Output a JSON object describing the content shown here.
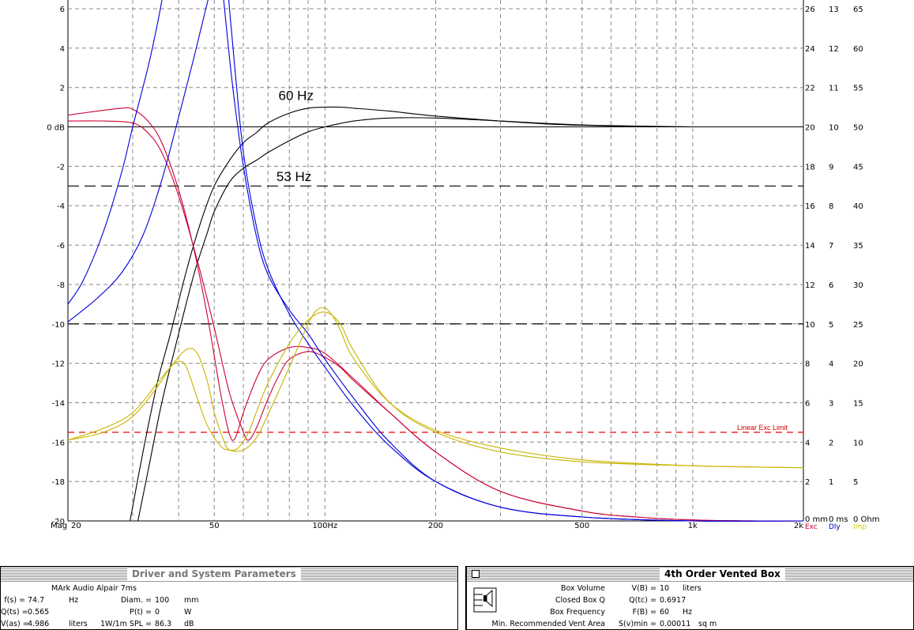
{
  "chart_data": {
    "type": "line",
    "xscale": "log",
    "xlim": [
      20,
      2000
    ],
    "ylim": [
      -20,
      6
    ],
    "x_ticks": [
      "20",
      "50",
      "100Hz",
      "200",
      "500",
      "1k",
      "2k"
    ],
    "x_axis_prefix": "Mag",
    "y_ticks": [
      "6",
      "4",
      "2",
      "0 dB",
      "-2",
      "-4",
      "-6",
      "-8",
      "-10",
      "-12",
      "-14",
      "-16",
      "-18",
      "-20"
    ],
    "right_axes": [
      {
        "values": [
          "26",
          "24",
          "22",
          "20",
          "18",
          "16",
          "14",
          "12",
          "10",
          "8",
          "6",
          "4",
          "2",
          "0 mm"
        ],
        "label": "Exc",
        "color": "#cc0033"
      },
      {
        "values": [
          "13",
          "12",
          "11",
          "10",
          "9",
          "8",
          "7",
          "6",
          "5",
          "4",
          "3",
          "2",
          "1",
          "0 ms"
        ],
        "label": "Dly",
        "color": "#0000cc"
      },
      {
        "values": [
          "65",
          "60",
          "55",
          "50",
          "45",
          "40",
          "35",
          "30",
          "25",
          "20",
          "15",
          "10",
          "5",
          "0 Ohm"
        ],
        "label": "Imp",
        "color": "#d8d000"
      }
    ],
    "reference_lines": [
      {
        "y": -3,
        "style": "long-dash",
        "color": "#000000"
      },
      {
        "y": -10,
        "style": "long-dash",
        "color": "#000000"
      },
      {
        "y": -15.5,
        "style": "dash",
        "color": "#ee0000",
        "label": "Linear Exc Limit"
      }
    ],
    "annotations": [
      {
        "text": "60 Hz",
        "x": 77,
        "y": 1.6
      },
      {
        "text": "53 Hz",
        "x": 76,
        "y": -2.5
      }
    ],
    "series": [
      {
        "color": "#000000",
        "x": [
          29.5,
          32,
          35,
          38,
          42,
          46,
          50,
          55,
          60,
          65,
          70,
          80,
          90,
          100,
          110,
          120,
          150,
          200,
          300,
          400,
          500,
          700,
          1000
        ],
        "y": [
          -20,
          -16.5,
          -13,
          -10.5,
          -7.3,
          -4.8,
          -3.0,
          -1.7,
          -0.8,
          -0.3,
          0.2,
          0.7,
          0.95,
          1.0,
          1.0,
          0.95,
          0.8,
          0.55,
          0.3,
          0.15,
          0.08,
          0.03,
          0.0
        ]
      },
      {
        "color": "#000000",
        "x": [
          31,
          33,
          36,
          40,
          44,
          48,
          50,
          55,
          60,
          65,
          70,
          80,
          90,
          100,
          120,
          150,
          200,
          300,
          500,
          1000
        ],
        "y": [
          -20,
          -17.5,
          -14,
          -10.5,
          -7.5,
          -5.3,
          -4.3,
          -2.8,
          -2.1,
          -1.7,
          -1.3,
          -0.7,
          -0.25,
          0.0,
          0.3,
          0.45,
          0.45,
          0.3,
          0.1,
          0.0
        ]
      },
      {
        "color": "#cc0033",
        "x": [
          20,
          24,
          28,
          30,
          33,
          36,
          40,
          44,
          48,
          52,
          55,
          57,
          60,
          65,
          70,
          80,
          90,
          100,
          120,
          150,
          200,
          300,
          500,
          700,
          1000,
          1500,
          2000
        ],
        "y": [
          0.6,
          0.8,
          0.95,
          0.9,
          0.3,
          -0.8,
          -3.2,
          -6.2,
          -9.7,
          -13.5,
          -15.6,
          -15.8,
          -14.5,
          -12.8,
          -11.8,
          -11.2,
          -11.2,
          -11.5,
          -12.8,
          -14.5,
          -16.5,
          -18.5,
          -19.5,
          -19.8,
          -19.95,
          -20,
          -20
        ]
      },
      {
        "color": "#cc0033",
        "x": [
          20,
          25,
          30,
          33,
          36,
          40,
          45,
          50,
          55,
          60,
          62,
          65,
          70,
          75,
          80,
          90,
          100,
          110,
          120,
          150,
          200,
          300,
          500,
          700,
          1000,
          1500,
          2000
        ],
        "y": [
          0.3,
          0.3,
          0.2,
          -0.3,
          -1.3,
          -3.5,
          -6.8,
          -10.2,
          -13.5,
          -15.5,
          -15.9,
          -15.3,
          -13.8,
          -12.6,
          -11.8,
          -11.4,
          -11.7,
          -12.2,
          -12.9,
          -14.5,
          -16.5,
          -18.5,
          -19.5,
          -19.8,
          -19.95,
          -20,
          -20
        ]
      },
      {
        "color": "#0000dd",
        "x": [
          20,
          22,
          25,
          28,
          30,
          33,
          35,
          37,
          40,
          42
        ],
        "y": [
          -9.0,
          -7.8,
          -5.3,
          -2.3,
          0.0,
          3.0,
          5.2,
          7.5,
          10.0,
          12.0
        ]
      },
      {
        "color": "#0000dd",
        "x": [
          20,
          24,
          28,
          32,
          36,
          40,
          44,
          47,
          49,
          50
        ],
        "y": [
          -9.9,
          -8.7,
          -7.4,
          -5.5,
          -2.7,
          0.5,
          3.5,
          5.7,
          7.1,
          8.0
        ]
      },
      {
        "color": "#0000dd",
        "x": [
          52,
          53,
          55,
          57,
          60,
          65,
          70,
          80,
          90,
          100,
          120,
          150,
          200,
          300,
          500,
          1000,
          2000
        ],
        "y": [
          8,
          6.5,
          3.5,
          1.0,
          -2.0,
          -5.5,
          -7.5,
          -9.3,
          -10.5,
          -11.8,
          -13.8,
          -16.0,
          -18.0,
          -19.3,
          -19.8,
          -20,
          -20
        ]
      },
      {
        "color": "#0000dd",
        "x": [
          54,
          55,
          57,
          60,
          65,
          70,
          80,
          90,
          100,
          120,
          150,
          200,
          300,
          500,
          1000,
          2000
        ],
        "y": [
          8,
          6.0,
          2.8,
          -1.3,
          -5.0,
          -7.2,
          -9.5,
          -11.0,
          -12.2,
          -14.2,
          -16.2,
          -18.0,
          -19.3,
          -19.8,
          -20,
          -20
        ]
      },
      {
        "color": "#c8b400",
        "x": [
          20,
          25,
          30,
          35,
          38,
          42,
          45,
          48,
          50,
          53,
          55,
          60,
          65,
          70,
          80,
          90,
          95,
          100,
          105,
          110,
          120,
          150,
          200,
          300,
          500,
          1000,
          2000
        ],
        "y": [
          -15.9,
          -15.5,
          -14.7,
          -13.2,
          -12.2,
          -11.3,
          -11.5,
          -13.0,
          -14.5,
          -15.9,
          -16.4,
          -16.4,
          -15.8,
          -14.6,
          -12.2,
          -10.0,
          -9.3,
          -9.2,
          -9.6,
          -10.3,
          -11.8,
          -14.0,
          -15.4,
          -16.3,
          -16.9,
          -17.2,
          -17.3
        ]
      },
      {
        "color": "#c8b400",
        "x": [
          20,
          25,
          30,
          35,
          38,
          40,
          42,
          45,
          48,
          52,
          55,
          58,
          62,
          65,
          70,
          80,
          90,
          100,
          110,
          120,
          150,
          200,
          300,
          500,
          1000,
          2000
        ],
        "y": [
          -15.9,
          -15.3,
          -14.5,
          -13.0,
          -12.2,
          -11.9,
          -12.2,
          -13.8,
          -15.2,
          -16.2,
          -16.4,
          -16.3,
          -15.5,
          -14.5,
          -13.0,
          -11.0,
          -9.8,
          -9.4,
          -10.0,
          -11.4,
          -14.0,
          -15.5,
          -16.5,
          -17.0,
          -17.2,
          -17.3
        ]
      }
    ]
  },
  "driver_panel": {
    "title": "Driver and System Parameters",
    "driver_name": "MArk Audio  Alpair 7ms",
    "fs_label": "f(s) =",
    "fs_value": "74.7",
    "fs_unit": "Hz",
    "diam_label": "Diam. =",
    "diam_value": "100",
    "diam_unit": "mm",
    "qts_label": "Q(ts) =",
    "qts_value": "0.565",
    "pt_label": "P(t) =",
    "pt_value": "0",
    "pt_unit": "W",
    "vas_label": "V(as) =",
    "vas_value": "4.986",
    "vas_unit": "liters",
    "spl_label": "1W/1m SPL =",
    "spl_value": "86.3",
    "spl_unit": "dB"
  },
  "box_panel": {
    "title": "4th Order Vented Box",
    "row1_name": "Box Volume",
    "row1_sym": "V(B) =",
    "row1_value": "10",
    "row1_unit": "liters",
    "row2_name": "Closed Box Q",
    "row2_sym": "Q(tc) =",
    "row2_value": "0.6917",
    "row3_name": "Box Frequency",
    "row3_sym": "F(B) =",
    "row3_value": "60",
    "row3_unit": "Hz",
    "row4_name": "Min. Recommended Vent Area",
    "row4_sym": "S(v)min =",
    "row4_value": "0.00011",
    "row4_unit": "sq m"
  }
}
